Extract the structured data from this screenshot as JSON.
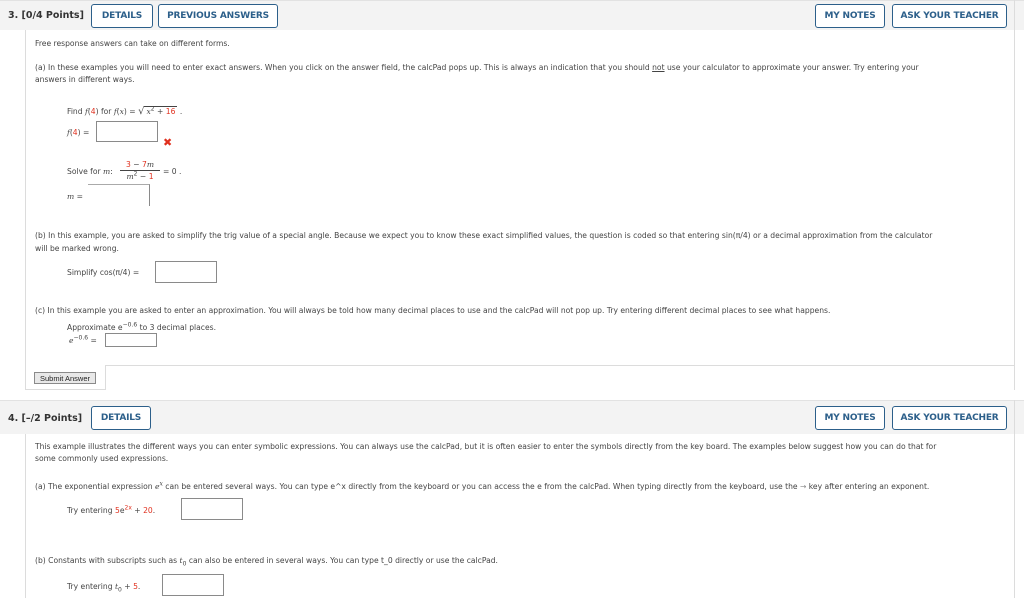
{
  "q3": {
    "number": "3.",
    "points": "[0/4 Points]",
    "details_label": "DETAILS",
    "previous_answers_label": "PREVIOUS ANSWERS",
    "my_notes_label": "MY NOTES",
    "ask_teacher_label": "ASK YOUR TEACHER",
    "intro": "Free response answers can take on different forms.",
    "part_a_line1_pre": "(a) In these examples you will need to enter exact answers. When you click on the answer field, the calcPad pops up. This is always an indication that you should ",
    "part_a_not": "not",
    "part_a_line1_post": " use your calculator to approximate your answer. Try entering your",
    "part_a_line2": "answers in different ways.",
    "find_label": "Find f(4) for f(x) = ",
    "find_f": "f",
    "find_arg": "4",
    "find_mid": ") for ",
    "find_fx": "f(x) = ",
    "sqrt_x": "x",
    "sqrt_exp": "2",
    "sqrt_plus": " + ",
    "sqrt_const": "16",
    "f4_label_f": "f",
    "f4_label_arg": "4",
    "f4_label_eq": ") =",
    "f4_value": "",
    "f4_status": "incorrect",
    "solve_label": "Solve for m:",
    "frac_num_a": "3",
    "frac_num_op": " − ",
    "frac_num_b": "7m",
    "frac_den_a": "m",
    "frac_den_exp": "2",
    "frac_den_op": " − ",
    "frac_den_b": "1",
    "frac_eq": "= 0 .",
    "m_label": "m =",
    "m_value": "",
    "part_b_line1": "(b) In this example, you are asked to simplify the trig value of a special angle. Because we expect you to know these exact simplified values, the question is coded so that entering  sin(π/4)  or a decimal approximation from the calculator",
    "part_b_line2": "will be marked wrong.",
    "simplify_label": "Simplify  cos(π/4)  =",
    "simplify_value": "",
    "part_c_line1": "(c) In this example you are asked to enter an approximation. You will always be told how many decimal places to use and the calcPad will not pop up. Try entering different decimal places to see what happens.",
    "approx_pre": "Approximate  e",
    "approx_exp": "−0.6",
    "approx_post": "  to 3 decimal places.",
    "approx_lhs_e": "e",
    "approx_lhs_exp": "−0.6",
    "approx_lhs_eq": " =",
    "approx_value": "",
    "submit_label": "Submit Answer"
  },
  "q4": {
    "number": "4.",
    "points": "[–/2 Points]",
    "details_label": "DETAILS",
    "my_notes_label": "MY NOTES",
    "ask_teacher_label": "ASK YOUR TEACHER",
    "intro_line1": "This example illustrates the different ways you can enter symbolic expressions. You can always use the calcPad, but it is often easier to enter the symbols directly from the key board. The examples below suggest how you can do that for",
    "intro_line2": "some commonly used expressions.",
    "part_a_pre": "(a) The exponential expression ",
    "part_a_e": "e",
    "part_a_x": "x",
    "part_a_mid": " can be entered several ways. You can type e^x directly from the keyboard or you can access the e from the calcPad. When typing directly from the keyboard, use the ",
    "part_a_arrow": "→",
    "part_a_post": " key after entering an exponent.",
    "try_a_pre": "Try entering ",
    "try_a_coef": "5",
    "try_a_e": "e",
    "try_a_exp": "2x",
    "try_a_plus": " + ",
    "try_a_const": "20",
    "try_a_end": ".",
    "try_a_value": "",
    "part_b_pre": "(b) Constants with subscripts such as ",
    "part_b_t": "t",
    "part_b_sub": "0",
    "part_b_post": " can also be entered in several ways. You can type t_0 directly or use the calcPad.",
    "try_b_pre": "Try entering ",
    "try_b_t": "t",
    "try_b_sub": "0",
    "try_b_plus": " + ",
    "try_b_const": "5",
    "try_b_end": ".",
    "try_b_value": ""
  },
  "colors": {
    "accent": "#2c5f8a",
    "error": "#e0301e",
    "header_bg": "#f3f3f3"
  }
}
